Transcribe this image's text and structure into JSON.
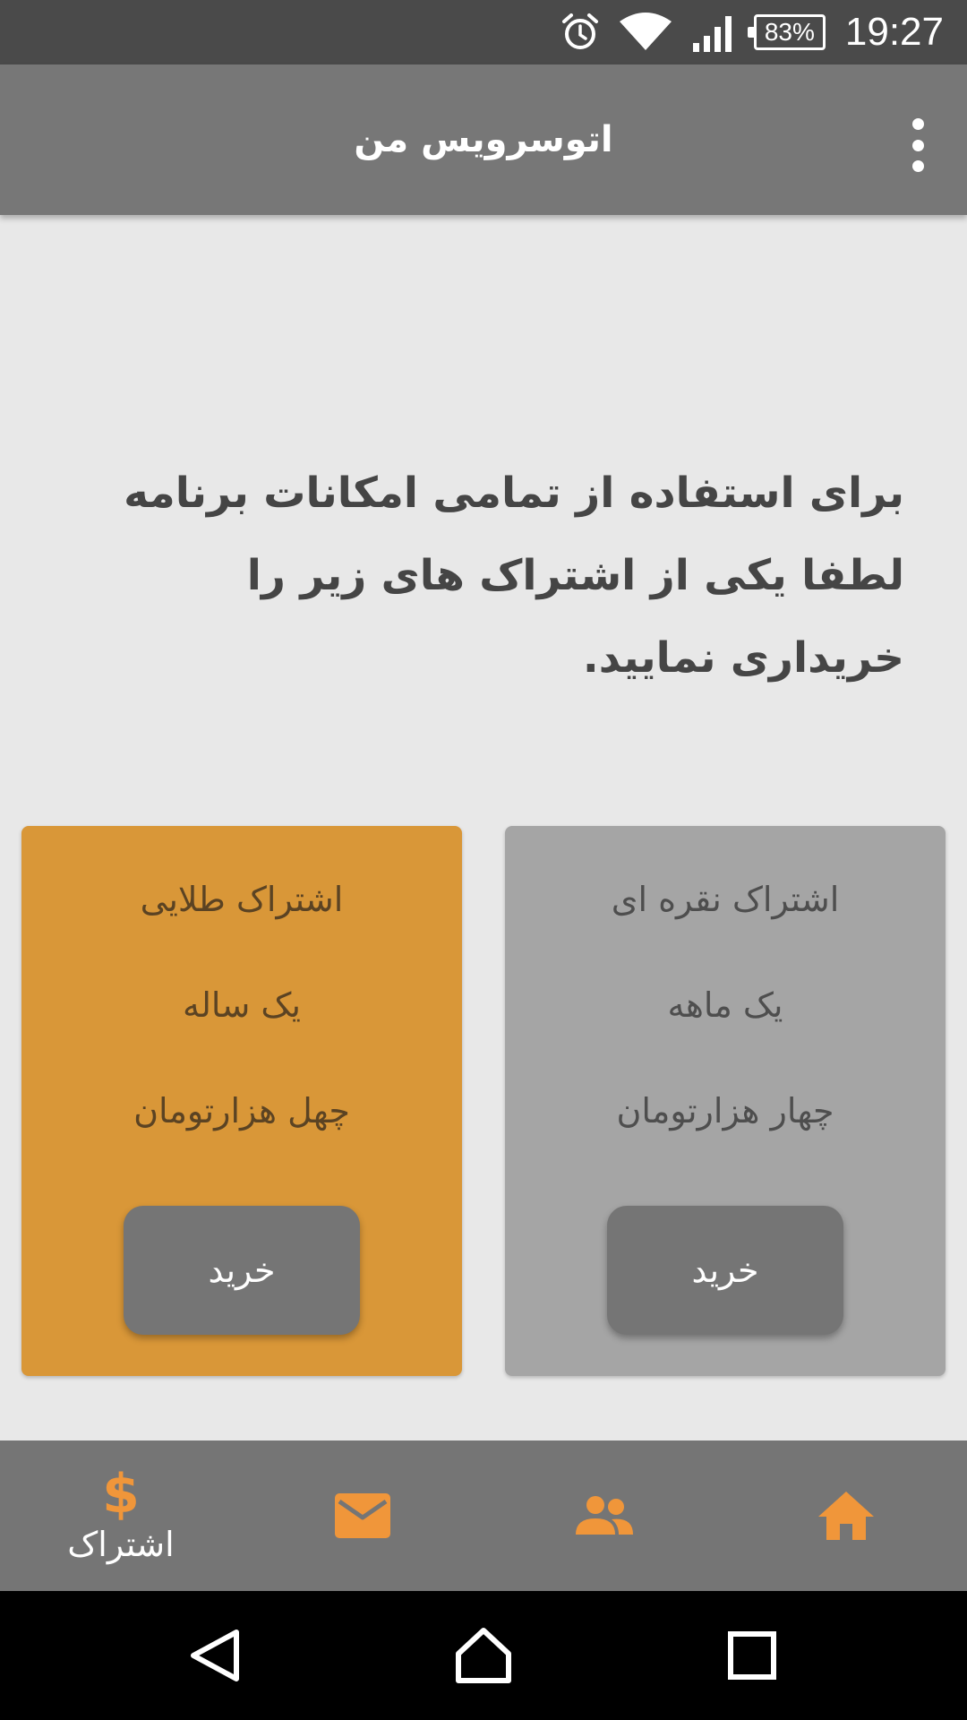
{
  "status_bar": {
    "time": "19:27",
    "battery": "83%"
  },
  "app_bar": {
    "title": "اتوسرویس من"
  },
  "message": "برای استفاده از تمامی امکانات برنامه لطفا یکی از اشتراک های زیر را خریداری نمایید.",
  "plans": [
    {
      "name": "اشتراک نقره ای",
      "duration": "یک ماهه",
      "price": "چهار هزارتومان",
      "button": "خرید",
      "color": "#a5a5a5"
    },
    {
      "name": "اشتراک طلایی",
      "duration": "یک ساله",
      "price": "چهل هزارتومان",
      "button": "خرید",
      "color": "#d99738"
    }
  ],
  "bottom_nav": {
    "items": [
      {
        "icon": "home-icon"
      },
      {
        "icon": "people-icon"
      },
      {
        "icon": "mail-icon"
      },
      {
        "icon": "dollar-icon",
        "glyph": "$",
        "label": "اشتراک",
        "active": true
      }
    ],
    "accent": "#f0963a"
  },
  "system_nav": {
    "buttons": [
      "back-icon",
      "home-outline-icon",
      "recents-icon"
    ]
  }
}
